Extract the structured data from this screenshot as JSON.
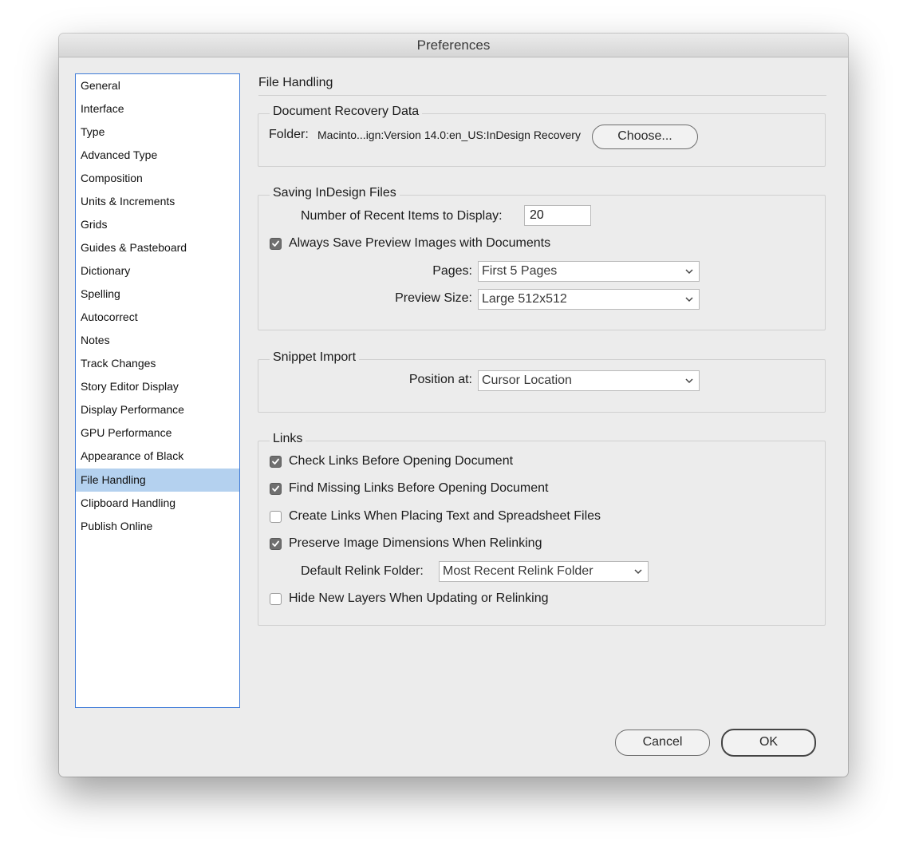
{
  "window": {
    "title": "Preferences"
  },
  "sidebar": {
    "items": [
      {
        "label": "General"
      },
      {
        "label": "Interface"
      },
      {
        "label": "Type"
      },
      {
        "label": "Advanced Type"
      },
      {
        "label": "Composition"
      },
      {
        "label": "Units & Increments"
      },
      {
        "label": "Grids"
      },
      {
        "label": "Guides & Pasteboard"
      },
      {
        "label": "Dictionary"
      },
      {
        "label": "Spelling"
      },
      {
        "label": "Autocorrect"
      },
      {
        "label": "Notes"
      },
      {
        "label": "Track Changes"
      },
      {
        "label": "Story Editor Display"
      },
      {
        "label": "Display Performance"
      },
      {
        "label": "GPU Performance"
      },
      {
        "label": "Appearance of Black"
      },
      {
        "label": "File Handling"
      },
      {
        "label": "Clipboard Handling"
      },
      {
        "label": "Publish Online"
      }
    ],
    "selected": "File Handling"
  },
  "main": {
    "section_title": "File Handling",
    "recovery": {
      "group_label": "Document Recovery Data",
      "folder_label": "Folder:",
      "folder_path": "Macinto...ign:Version 14.0:en_US:InDesign Recovery",
      "choose_button": "Choose..."
    },
    "saving": {
      "group_label": "Saving InDesign Files",
      "recent_items_label": "Number of Recent Items to Display:",
      "recent_items_value": "20",
      "save_preview_label": "Always Save Preview Images with Documents",
      "save_preview_checked": true,
      "pages_label": "Pages:",
      "pages_value": "First 5 Pages",
      "preview_size_label": "Preview Size:",
      "preview_size_value": "Large 512x512"
    },
    "snippet": {
      "group_label": "Snippet Import",
      "position_label": "Position at:",
      "position_value": "Cursor Location"
    },
    "links": {
      "group_label": "Links",
      "check_links_label": "Check Links Before Opening Document",
      "check_links_checked": true,
      "find_missing_label": "Find Missing Links Before Opening Document",
      "find_missing_checked": true,
      "create_links_label": "Create Links When Placing Text and Spreadsheet Files",
      "create_links_checked": false,
      "preserve_dims_label": "Preserve Image Dimensions When Relinking",
      "preserve_dims_checked": true,
      "relink_folder_label": "Default Relink Folder:",
      "relink_folder_value": "Most Recent Relink Folder",
      "hide_layers_label": "Hide New Layers When Updating or Relinking",
      "hide_layers_checked": false
    }
  },
  "footer": {
    "cancel_button": "Cancel",
    "ok_button": "OK"
  }
}
